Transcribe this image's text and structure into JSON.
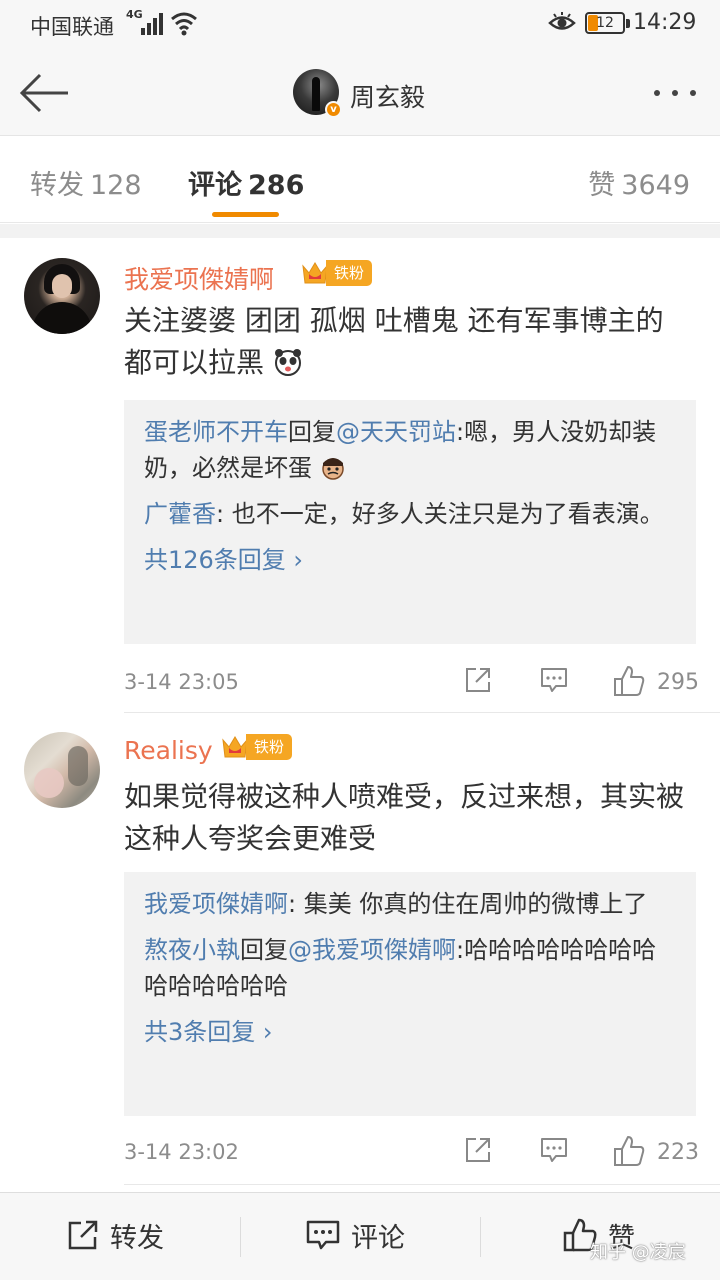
{
  "status_bar": {
    "carrier": "中国联通",
    "network": "4G",
    "battery": "12",
    "time": "14:29"
  },
  "nav": {
    "title": "周玄毅",
    "verified_mark": "v"
  },
  "tabs": [
    {
      "label": "转发",
      "count": "128"
    },
    {
      "label": "评论",
      "count": "286"
    },
    {
      "label": "赞",
      "count": "3649"
    }
  ],
  "comments": [
    {
      "user": "我爱项傑婧啊",
      "badge": "铁粉",
      "text": "关注婆婆 团团 孤烟 吐槽鬼 还有军事博主的 都可以拉黑",
      "emoji": "panda-emoji",
      "replies": [
        {
          "user": "蛋老师不开车",
          "mid": "回复",
          "mention": "@天天罚站",
          "text": ":嗯，男人没奶却装奶，必然是坏蛋"
        },
        {
          "user": "广藿香",
          "mid": "",
          "mention": "",
          "text": ": 也不一定，好多人关注只是为了看表演。"
        }
      ],
      "more_replies": "共126条回复 ›",
      "time": "3-14 23:05",
      "likes": "295"
    },
    {
      "user": "Realisy",
      "badge": "铁粉",
      "text": "如果觉得被这种人喷难受，反过来想，其实被这种人夸奖会更难受",
      "replies": [
        {
          "user": "我爱项傑婧啊",
          "mid": "",
          "mention": "",
          "text": ": 集美 你真的住在周帅的微博上了"
        },
        {
          "user": "熬夜小執",
          "mid": "回复",
          "mention": "@我爱项傑婧啊",
          "text": ":哈哈哈哈哈哈哈哈哈哈哈哈哈哈"
        }
      ],
      "more_replies": "共3条回复 ›",
      "time": "3-14 23:02",
      "likes": "223"
    }
  ],
  "toolbar": {
    "repost": "转发",
    "comment": "评论",
    "like": "赞"
  },
  "watermark": "知乎 @凌宸",
  "colors": {
    "accent": "#f08a00",
    "username": "#eb7350",
    "link": "#507daf",
    "badge": "#f5a623"
  }
}
